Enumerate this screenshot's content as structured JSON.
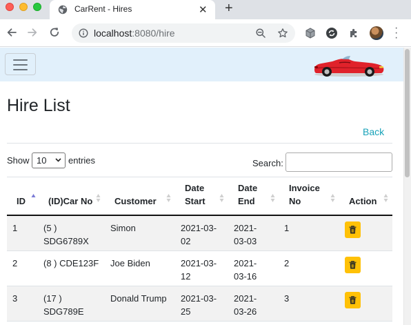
{
  "browser": {
    "tab_title": "CarRent - Hires",
    "url_host": "localhost",
    "url_rest": ":8080/hire"
  },
  "page": {
    "title": "Hire List",
    "back_label": "Back",
    "show_label": "Show",
    "page_length": "10",
    "entries_label": "entries",
    "search_label": "Search:",
    "search_value": ""
  },
  "table": {
    "columns": [
      {
        "line1": "ID",
        "line2": ""
      },
      {
        "line1": "(ID)Car No",
        "line2": ""
      },
      {
        "line1": "Customer",
        "line2": ""
      },
      {
        "line1": "Date",
        "line2": "Start"
      },
      {
        "line1": "Date",
        "line2": "End"
      },
      {
        "line1": "Invoice",
        "line2": "No"
      },
      {
        "line1": "Action",
        "line2": ""
      }
    ],
    "sorted_column": "ID",
    "rows": [
      {
        "id": "1",
        "car_a": "(5 )",
        "car_b": "SDG6789X",
        "customer": "Simon",
        "start_a": "2021-03-",
        "start_b": "02",
        "end_a": "2021-",
        "end_b": "03-03",
        "invoice": "1"
      },
      {
        "id": "2",
        "car_a": "(8 ) CDE123F",
        "car_b": "",
        "customer": "Joe Biden",
        "start_a": "2021-03-",
        "start_b": "12",
        "end_a": "2021-",
        "end_b": "03-16",
        "invoice": "2"
      },
      {
        "id": "3",
        "car_a": "(17 )",
        "car_b": "SDG789E",
        "customer": "Donald Trump",
        "start_a": "2021-03-",
        "start_b": "25",
        "end_a": "2021-",
        "end_b": "03-26",
        "invoice": "3"
      }
    ]
  },
  "icons": {
    "favicon": "globe-icon",
    "delete": "trash-icon",
    "logo": "red-convertible-car-logo"
  },
  "colors": {
    "navbar_bg": "#e1f0fb",
    "link": "#17a2b8",
    "delete_button": "#ffc107",
    "sort_active": "#7b7bd6"
  }
}
